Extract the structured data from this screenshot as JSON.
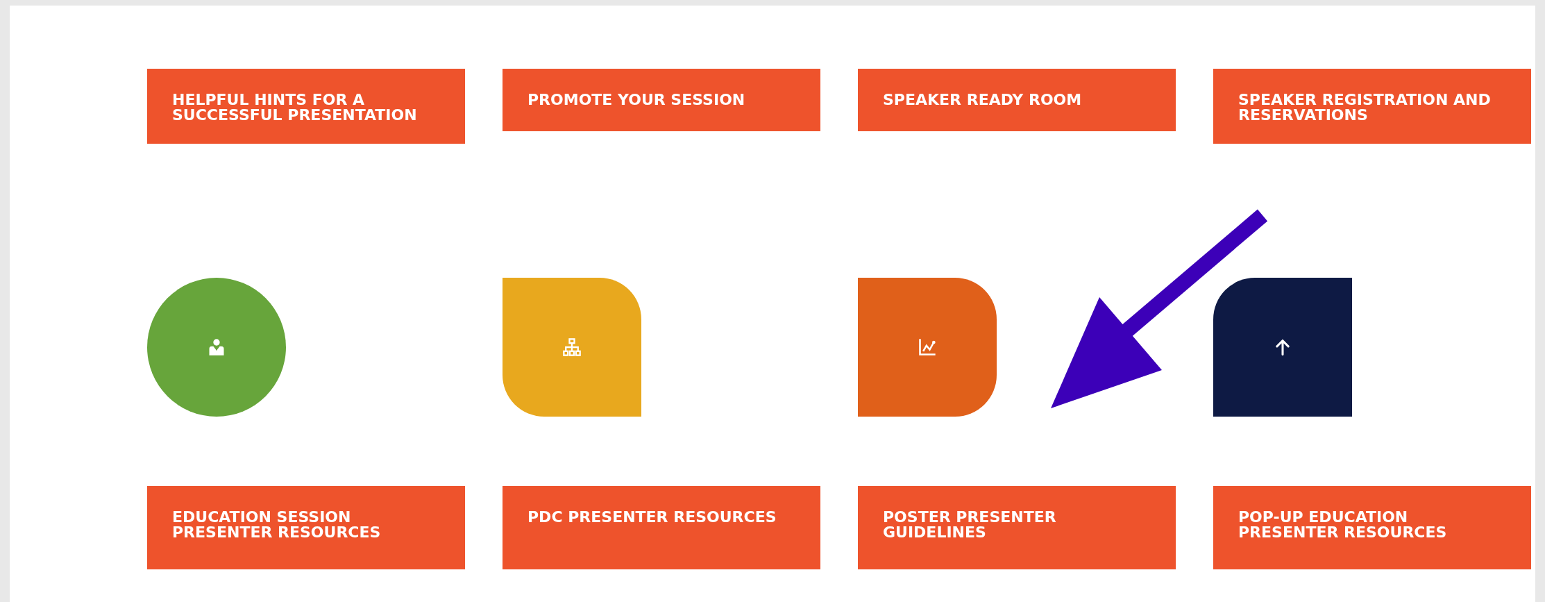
{
  "top_links": [
    {
      "label": "HELPFUL HINTS FOR A SUCCESSFUL PRESENTATION"
    },
    {
      "label": "PROMOTE YOUR SESSION"
    },
    {
      "label": "SPEAKER READY ROOM"
    },
    {
      "label": "SPEAKER REGISTRATION AND RESERVATIONS"
    }
  ],
  "tiles": [
    {
      "kind": "circle",
      "color": "#67a53b"
    },
    {
      "kind": "leaf",
      "color": "#e8a81e"
    },
    {
      "kind": "tab",
      "color": "#e0601a"
    },
    {
      "kind": "corner",
      "color": "#0e1a44"
    }
  ],
  "bottom_links": [
    {
      "label": "EDUCATION SESSION PRESENTER RESOURCES"
    },
    {
      "label": "PDC PRESENTER RESOURCES"
    },
    {
      "label": "POSTER PRESENTER GUIDELINES"
    },
    {
      "label": "POP-UP EDUCATION PRESENTER RESOURCES"
    }
  ]
}
